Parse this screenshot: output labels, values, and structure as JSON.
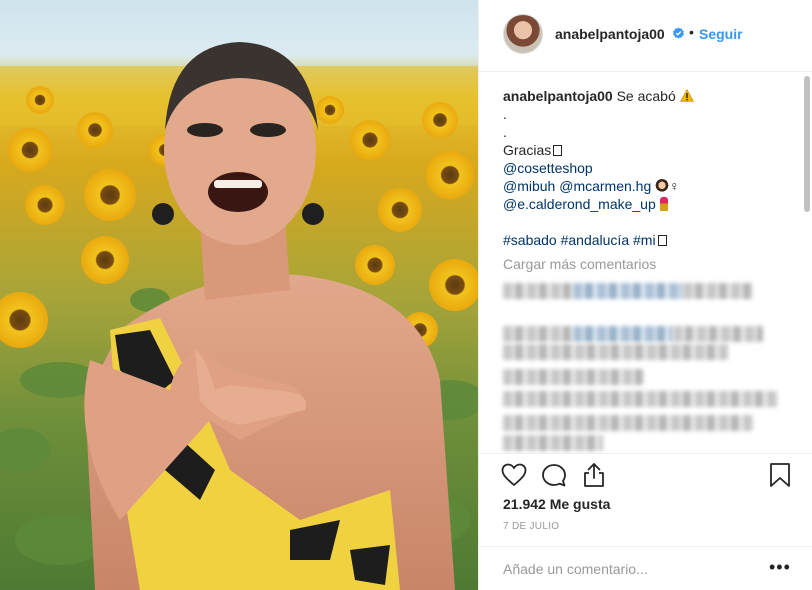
{
  "post": {
    "username": "anabelpantoja00",
    "follow_label": "Seguir",
    "separator": "•",
    "caption": {
      "username": "anabelpantoja00",
      "text": "Se acabó",
      "line2": ".",
      "line3": ".",
      "line4": "Gracias",
      "mention1": "@cosetteshop",
      "mention2": "@mibuh",
      "mention3": "@mcarmen.hg",
      "mention3_suffix": "♀",
      "mention4": "@e.calderond_make_up",
      "hashtag1": "#sabado",
      "hashtag2": "#andalucía",
      "hashtag3": "#mi"
    },
    "load_more": "Cargar más comentarios",
    "likes": "21.942 Me gusta",
    "date": "7 DE JULIO",
    "comment_placeholder": "Añade un comentario...",
    "more_options": "•••"
  },
  "icons": {
    "verified": "verified-badge-icon",
    "like": "heart-icon",
    "comment": "comment-icon",
    "share": "share-icon",
    "save": "bookmark-icon",
    "warning": "warning-icon"
  },
  "colors": {
    "link": "#003569",
    "follow": "#3897f0",
    "muted": "#999999",
    "text": "#262626"
  }
}
